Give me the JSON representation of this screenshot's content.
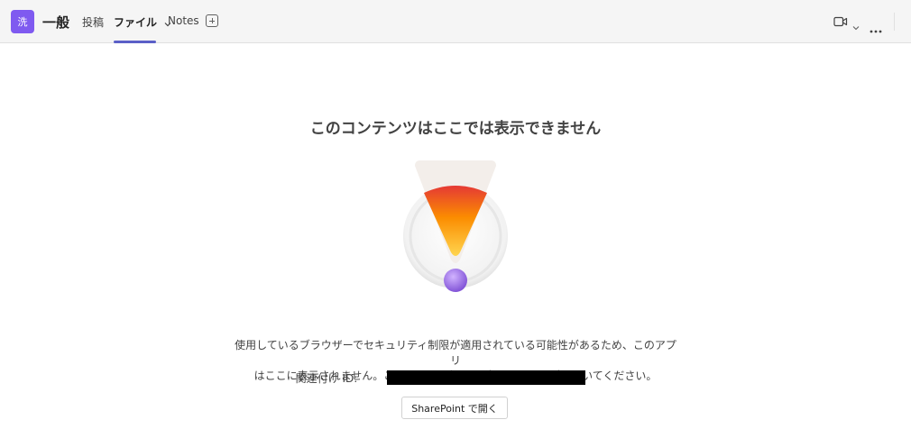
{
  "header": {
    "avatar_text": "洗",
    "channel_title": "一般",
    "tabs": [
      {
        "label": "投稿"
      },
      {
        "label": "ファイル"
      },
      {
        "label": "Notes"
      }
    ],
    "active_tab": "ファイル",
    "accent_color": "#5b5fc7",
    "avatar_color": "#7f5af0"
  },
  "main": {
    "heading": "このコンテンツはここでは表示できません",
    "message_line1": "使用しているブラウザーでセキュリティ制限が適用されている可能性があるため、このアプリ",
    "message_line2": "はここに表示されません。このアプリは新しいブラウザー タブで開いてください。",
    "id_label": "関連付け ID:",
    "open_button_label": "SharePoint で開く"
  },
  "icons": {
    "add_tab": "add-tab-icon",
    "video": "video-camera-icon",
    "more": "more-options-icon",
    "warning": "warning-exclamation-illustration"
  }
}
